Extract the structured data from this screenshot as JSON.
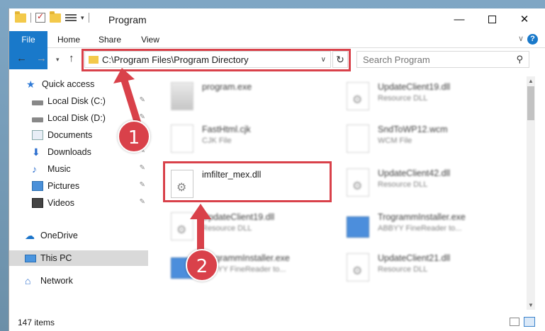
{
  "window": {
    "title": "Program"
  },
  "ribbon": {
    "tabs": [
      {
        "label": "File"
      },
      {
        "label": "Home"
      },
      {
        "label": "Share"
      },
      {
        "label": "View"
      }
    ]
  },
  "address_bar": {
    "path": "C:\\Program Files\\Program Directory"
  },
  "search": {
    "placeholder": "Search Program"
  },
  "sidebar": {
    "quick_access": "Quick access",
    "items": [
      {
        "label": "Local Disk (C:)"
      },
      {
        "label": "Local Disk (D:)"
      },
      {
        "label": "Documents"
      },
      {
        "label": "Downloads"
      },
      {
        "label": "Music"
      },
      {
        "label": "Pictures"
      },
      {
        "label": "Videos"
      }
    ],
    "onedrive": "OneDrive",
    "this_pc": "This PC",
    "network": "Network"
  },
  "files": {
    "left": [
      {
        "name": "program.exe",
        "type": ""
      },
      {
        "name": "FastHtml.cjk",
        "type": "CJK File"
      },
      {
        "name": "imfilter_mex.dll",
        "type": ""
      },
      {
        "name": "UpdateClient19.dll",
        "type": "Resource DLL"
      },
      {
        "name": "TrogrammInstaller.exe",
        "type": "ABBYY FineReader to..."
      }
    ],
    "right": [
      {
        "name": "UpdateClient19.dll",
        "type": "Resource DLL"
      },
      {
        "name": "SndToWP12.wcm",
        "type": "WCM File"
      },
      {
        "name": "UpdateClient42.dll",
        "type": "Resource DLL"
      },
      {
        "name": "TrogrammInstaller.exe",
        "type": "ABBYY FineReader to..."
      },
      {
        "name": "UpdateClient21.dll",
        "type": "Resource DLL"
      }
    ]
  },
  "status": {
    "item_count": "147 items"
  },
  "annotations": {
    "step1": "1",
    "step2": "2"
  },
  "colors": {
    "accent": "#1979ca",
    "highlight": "#d9414a"
  }
}
